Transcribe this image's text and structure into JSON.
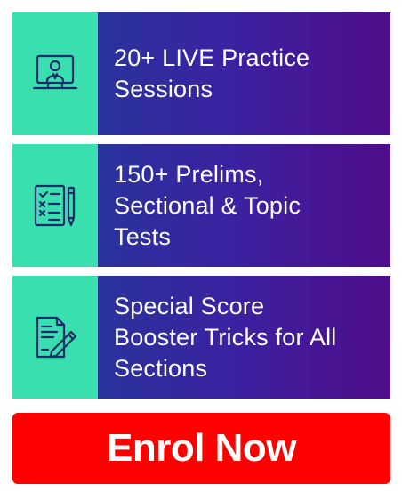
{
  "features": [
    {
      "text": "20+ LIVE Practice\nSessions",
      "icon": "live-session-icon"
    },
    {
      "text": "150+ Prelims,\nSectional & Topic\nTests",
      "icon": "test-checklist-icon"
    },
    {
      "text": "Special Score\nBooster Tricks for All\nSections",
      "icon": "document-pen-icon"
    }
  ],
  "cta": {
    "label": "Enrol Now"
  },
  "colors": {
    "icon_panel": "#39dfae",
    "gradient_start": "#29339d",
    "gradient_end": "#4f0d8a",
    "cta": "#ff0000",
    "icon_stroke": "#1f2a6b"
  }
}
